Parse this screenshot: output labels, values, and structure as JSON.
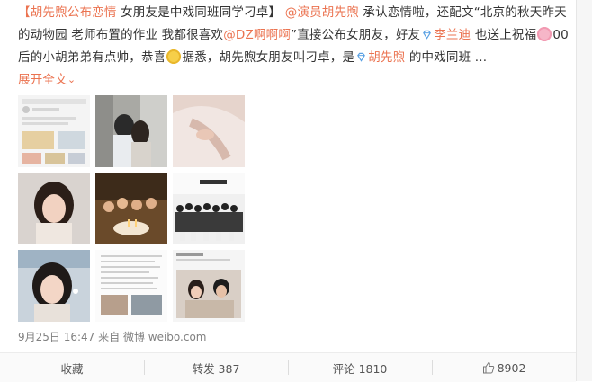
{
  "post": {
    "tag": "【胡先煦公布恋情",
    "headline": " 女朋友是中戏同班同学刁卓】",
    "mention1": "@演员胡先煦",
    "text1": " 承认恋情啦，还配文“北京的秋天昨天的动物园 老师布置的作业 我都很喜欢",
    "mention2": "@DZ啊啊啊",
    "text2": "”直接公布女朋友，好友",
    "friend1": "李兰迪",
    "text3": " 也送上祝福",
    "text4": "00后的小胡弟弟有点帅，恭喜",
    "text5": "据悉，胡先煦女朋友叫刁卓，是",
    "friend2": "胡先煦",
    "text6": " 的中戏同班 ...",
    "expand_label": "展开全文",
    "expand_icon": "chevron-down-icon",
    "emoji1": "pig-emoji",
    "emoji2": "clap-emoji"
  },
  "images": [
    "screenshot-post-thumb",
    "couple-elevator-thumb",
    "hand-dress-thumb",
    "girl-portrait-thumb",
    "group-birthday-thumb",
    "class-photo-thumb",
    "girl-train-selfie-thumb",
    "article-screenshot-thumb",
    "news-collage-thumb"
  ],
  "meta": {
    "time": "9月25日 16:47",
    "via": " 来自 ",
    "source": "微博 weibo.com"
  },
  "actions": {
    "favorite": "收藏",
    "repost": "转发 387",
    "comment": "评论 1810",
    "like": "8902"
  },
  "colors": {
    "link": "#eb7350",
    "mention_blue": "#507daf",
    "meta_gray": "#808080"
  }
}
